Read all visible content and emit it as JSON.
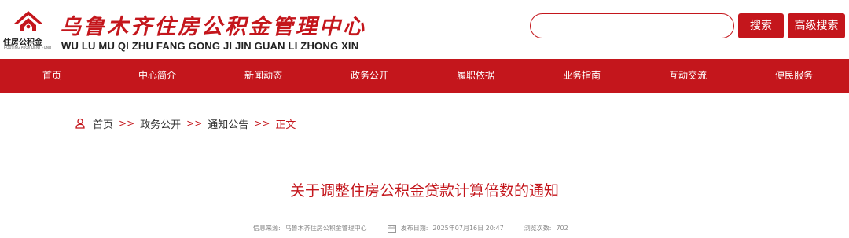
{
  "header": {
    "logo_text": "住房公积金",
    "logo_subtext": "HOUSING PROVIDENT FUND",
    "site_title": "乌鲁木齐住房公积金管理中心",
    "site_pinyin": "WU LU MU QI ZHU FANG GONG JI JIN GUAN LI ZHONG XIN",
    "search": {
      "value": "",
      "placeholder": ""
    },
    "search_button": "搜索",
    "advanced_search_button": "高级搜索",
    "brand_color": "#c4161c"
  },
  "nav": {
    "items": [
      {
        "label": "首页"
      },
      {
        "label": "中心简介"
      },
      {
        "label": "新闻动态"
      },
      {
        "label": "政务公开"
      },
      {
        "label": "履职依据"
      },
      {
        "label": "业务指南"
      },
      {
        "label": "互动交流"
      },
      {
        "label": "便民服务"
      }
    ]
  },
  "breadcrumb": {
    "items": [
      "首页",
      "政务公开",
      "通知公告"
    ],
    "separator": ">>",
    "current": "正文"
  },
  "article": {
    "title": "关于调整住房公积金贷款计算倍数的通知",
    "source_label": "信息来源:",
    "source": "乌鲁木齐住房公积金管理中心",
    "date_label": "发布日期:",
    "date": "2025年07月16日 20:47",
    "views_label": "浏览次数:",
    "views": "702"
  }
}
